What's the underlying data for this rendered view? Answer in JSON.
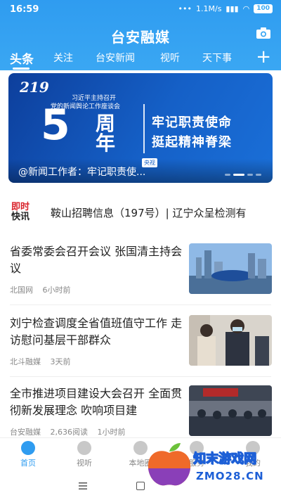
{
  "status": {
    "time": "16:59",
    "speed": "1.1M/s",
    "battery": "100"
  },
  "header": {
    "logo": "台安融媒"
  },
  "tabs": [
    {
      "label": "头条",
      "active": true
    },
    {
      "label": "关注"
    },
    {
      "label": "台安新闻"
    },
    {
      "label": "视听"
    },
    {
      "label": "天下事"
    }
  ],
  "banner": {
    "date_num": "219",
    "caption1": "习近平主持召开",
    "caption2": "党的新闻舆论工作座谈会",
    "big": "5",
    "zhounian": "周年",
    "slogan1": "牢记职责使命",
    "slogan2": "挺起精神脊梁",
    "title": "@新闻工作者：牢记职责使...",
    "badge": "央视"
  },
  "ticker": {
    "tag_top": "即时",
    "tag_bottom": "快讯",
    "text": "鞍山招聘信息（197号）| 辽宁众呈检测有"
  },
  "news": [
    {
      "title": "省委常委会召开会议 张国清主持会议",
      "source": "北国网",
      "time": "6小时前",
      "reads": ""
    },
    {
      "title": "刘宁检查调度全省值班值守工作 走访慰问基层干部群众",
      "source": "北斗融媒",
      "time": "3天前",
      "reads": ""
    },
    {
      "title": "全市推进项目建设大会召开 全面贯彻新发展理念 吹响项目建",
      "source": "台安融媒",
      "time": "1小时前",
      "reads": "2,636阅读"
    }
  ],
  "bottom_nav": [
    {
      "label": "首页",
      "active": true
    },
    {
      "label": "视听"
    },
    {
      "label": "本地圈"
    },
    {
      "label": "服务"
    },
    {
      "label": "我的"
    }
  ],
  "watermark": {
    "line1": "知末游戏网",
    "line2": "ZMO28.CN"
  },
  "colors": {
    "brand": "#2f9cf0",
    "ticker_red": "#d9232b"
  }
}
